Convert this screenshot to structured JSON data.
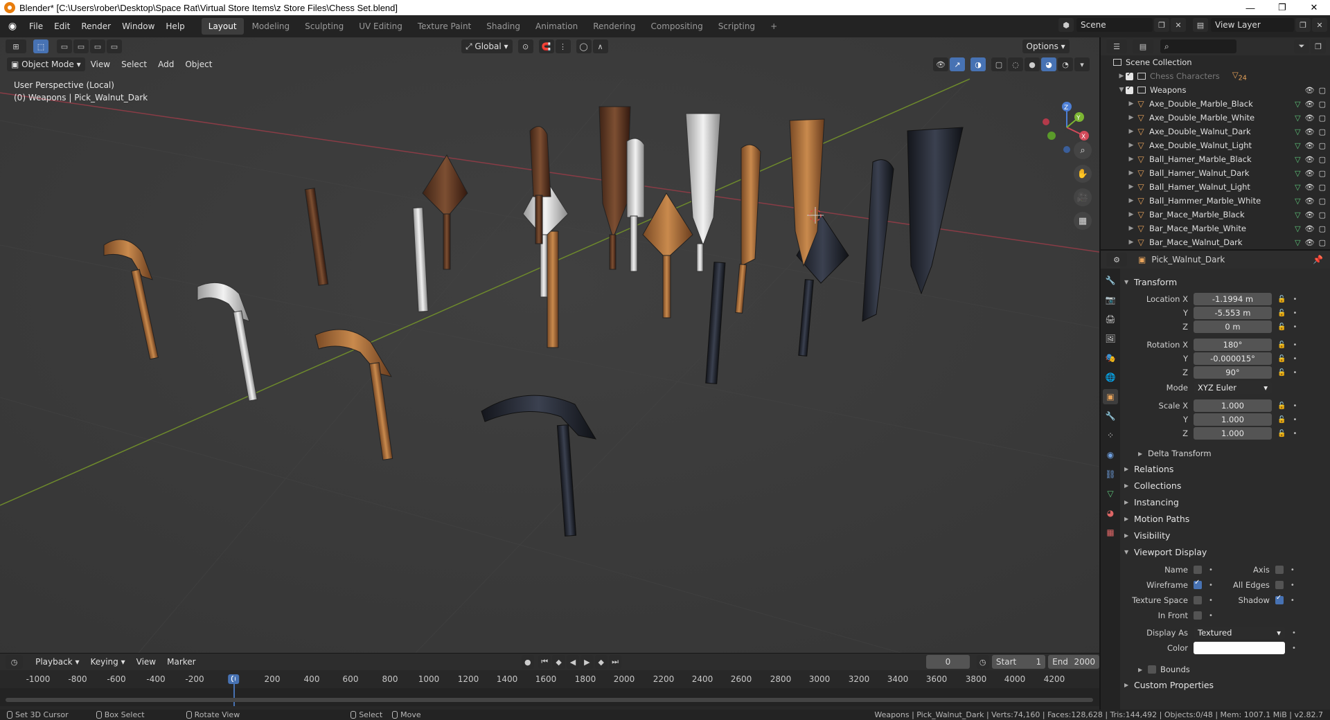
{
  "window": {
    "title": "Blender* [C:\\Users\\rober\\Desktop\\Space Rat\\Virtual Store Items\\z Store Files\\Chess Set.blend]",
    "controls": [
      "—",
      "❐",
      "✕"
    ]
  },
  "menu": [
    "File",
    "Edit",
    "Render",
    "Window",
    "Help"
  ],
  "workspaces": [
    "Layout",
    "Modeling",
    "Sculpting",
    "UV Editing",
    "Texture Paint",
    "Shading",
    "Animation",
    "Rendering",
    "Compositing",
    "Scripting",
    "+"
  ],
  "topright": {
    "scene": "Scene",
    "view_layer": "View Layer"
  },
  "viewport": {
    "mode": "Object Mode",
    "menus": [
      "View",
      "Select",
      "Add",
      "Object"
    ],
    "orientation": "Global",
    "options": "Options",
    "perspective": "User Perspective (Local)",
    "collection_info": "(0) Weapons | Pick_Walnut_Dark",
    "gizmo": {
      "z": "Z",
      "y": "Y",
      "x": "X"
    }
  },
  "timeline": {
    "menus": [
      "Playback",
      "Keying",
      "View",
      "Marker"
    ],
    "current_frame": "0",
    "start_label": "Start",
    "start": "1",
    "end_label": "End",
    "end": "2000",
    "ruler": [
      "-1000",
      "-800",
      "-600",
      "-400",
      "-200",
      "0",
      "200",
      "400",
      "600",
      "800",
      "1000",
      "1200",
      "1400",
      "1600",
      "1800",
      "2000",
      "2200",
      "2400",
      "2600",
      "2800",
      "3000",
      "3200",
      "3400",
      "3600",
      "3800",
      "4000",
      "4200"
    ]
  },
  "status": {
    "hints": [
      "Set 3D Cursor",
      "Box Select",
      "Rotate View",
      "Select",
      "Move"
    ],
    "stats": "Weapons | Pick_Walnut_Dark | Verts:74,160 | Faces:128,628 | Tris:144,492 | Objects:0/48 | Mem: 1007.1 MiB | v2.82.7"
  },
  "outliner": {
    "scene_collection": "Scene Collection",
    "chess_characters": "Chess Characters",
    "chess_characters_count": "24",
    "weapons": "Weapons",
    "items": [
      "Axe_Double_Marble_Black",
      "Axe_Double_Marble_White",
      "Axe_Double_Walnut_Dark",
      "Axe_Double_Walnut_Light",
      "Ball_Hamer_Marble_Black",
      "Ball_Hamer_Walnut_Dark",
      "Ball_Hamer_Walnut_Light",
      "Ball_Hammer_Marble_White",
      "Bar_Mace_Marble_Black",
      "Bar_Mace_Marble_White",
      "Bar_Mace_Walnut_Dark"
    ]
  },
  "properties": {
    "object_name": "Pick_Walnut_Dark",
    "transform": {
      "title": "Transform",
      "location_x_label": "Location X",
      "location_x": "-1.1994 m",
      "location_y_label": "Y",
      "location_y": "-5.553 m",
      "location_z_label": "Z",
      "location_z": "0 m",
      "rotation_x_label": "Rotation X",
      "rotation_x": "180°",
      "rotation_y_label": "Y",
      "rotation_y": "-0.000015°",
      "rotation_z_label": "Z",
      "rotation_z": "90°",
      "mode_label": "Mode",
      "mode": "XYZ Euler",
      "scale_x_label": "Scale X",
      "scale_x": "1.000",
      "scale_y_label": "Y",
      "scale_y": "1.000",
      "scale_z_label": "Z",
      "scale_z": "1.000"
    },
    "delta_transform": "Delta Transform",
    "sections": [
      "Relations",
      "Collections",
      "Instancing",
      "Motion Paths",
      "Visibility"
    ],
    "viewport_display": {
      "title": "Viewport Display",
      "name": "Name",
      "axis": "Axis",
      "wireframe": "Wireframe",
      "all_edges": "All Edges",
      "texture_space": "Texture Space",
      "shadow": "Shadow",
      "in_front": "In Front",
      "display_as_label": "Display As",
      "display_as": "Textured",
      "color_label": "Color",
      "bounds": "Bounds"
    },
    "custom_properties": "Custom Properties"
  },
  "colors": {
    "accent": "#4772b3",
    "object_orange": "#e8a35a",
    "mesh_green": "#5ec47a",
    "axis_x": "#b5384a",
    "axis_y": "#6e9a2c"
  }
}
